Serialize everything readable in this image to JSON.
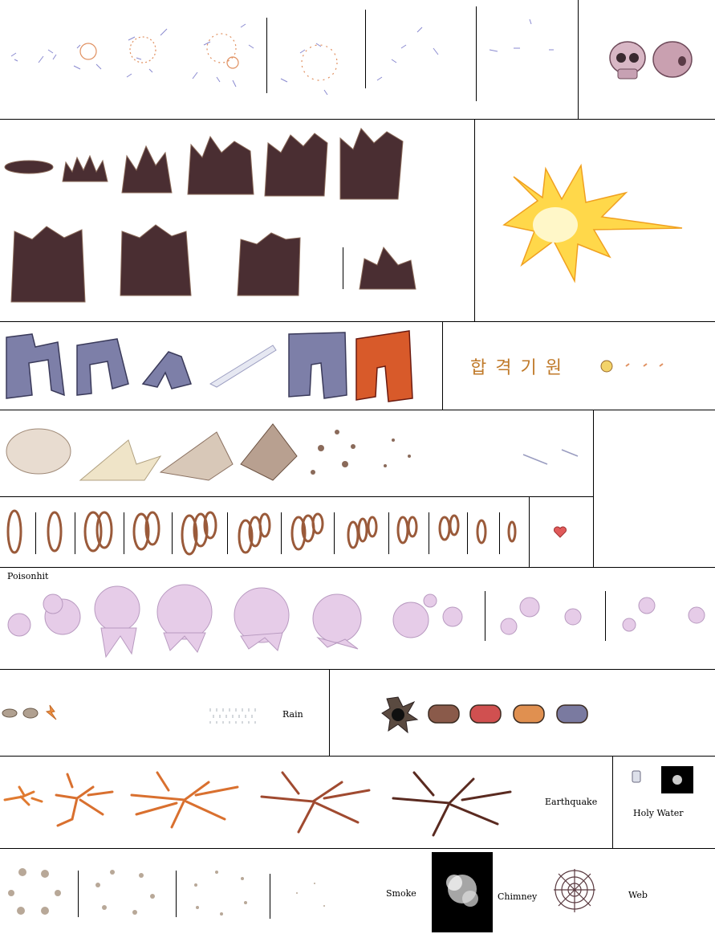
{
  "sheet": {
    "title": "",
    "colors": {
      "outline": "#000000",
      "sand": "#4a2e32",
      "flash": "#ffd84a",
      "poison": "#e6cce8",
      "bolt": "#c06a2a",
      "crack": "#d9702f",
      "ring": "#9a5a3a",
      "heart": "#e05a5a",
      "stone": "#7d7fa8",
      "stone_red": "#d85a2a"
    }
  },
  "rows": {
    "row1": {
      "icon": "skull-icon"
    },
    "row3": {
      "korean_text": "합 격 기 원"
    },
    "row6": {
      "label": "Poisonhit"
    },
    "row7": {
      "rain_label": "Rain"
    },
    "row8": {
      "earthquake_label": "Earthquake",
      "holy_water_label": "Holy Water"
    },
    "row9": {
      "smoke_label": "Smoke",
      "chimney_label": "Chimney",
      "web_label": "Web"
    }
  }
}
